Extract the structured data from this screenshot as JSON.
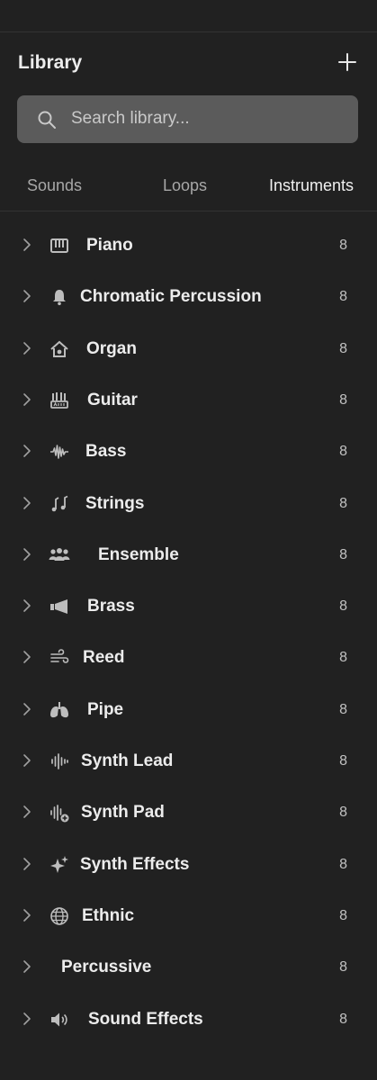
{
  "library": {
    "title": "Library",
    "add_icon": "plus-icon",
    "search": {
      "placeholder": "Search library...",
      "icon": "search-icon"
    },
    "tabs": [
      {
        "label": "Sounds",
        "active": false
      },
      {
        "label": "Loops",
        "active": false
      },
      {
        "label": "Instruments",
        "active": true
      }
    ],
    "items": [
      {
        "label": "Piano",
        "count": "8",
        "icon": "piano-icon"
      },
      {
        "label": "Chromatic Percussion",
        "count": "8",
        "icon": "bell-icon"
      },
      {
        "label": "Organ",
        "count": "8",
        "icon": "organ-house-icon"
      },
      {
        "label": "Guitar",
        "count": "8",
        "icon": "guitar-icon"
      },
      {
        "label": "Bass",
        "count": "8",
        "icon": "waveform-icon"
      },
      {
        "label": "Strings",
        "count": "8",
        "icon": "music-notes-icon"
      },
      {
        "label": "Ensemble",
        "count": "8",
        "icon": "group-icon"
      },
      {
        "label": "Brass",
        "count": "8",
        "icon": "megaphone-icon"
      },
      {
        "label": "Reed",
        "count": "8",
        "icon": "wind-icon"
      },
      {
        "label": "Pipe",
        "count": "8",
        "icon": "lungs-icon"
      },
      {
        "label": "Synth Lead",
        "count": "8",
        "icon": "waveform-lines-icon"
      },
      {
        "label": "Synth Pad",
        "count": "8",
        "icon": "waveform-plus-icon"
      },
      {
        "label": "Synth Effects",
        "count": "8",
        "icon": "sparkles-icon"
      },
      {
        "label": "Ethnic",
        "count": "8",
        "icon": "globe-icon"
      },
      {
        "label": "Percussive",
        "count": "8",
        "icon": ""
      },
      {
        "label": "Sound Effects",
        "count": "8",
        "icon": "speaker-icon"
      }
    ]
  },
  "colors": {
    "background": "#212121",
    "search_background": "#5b5b5b",
    "text": "#ececec",
    "muted": "#a7a7a7"
  }
}
